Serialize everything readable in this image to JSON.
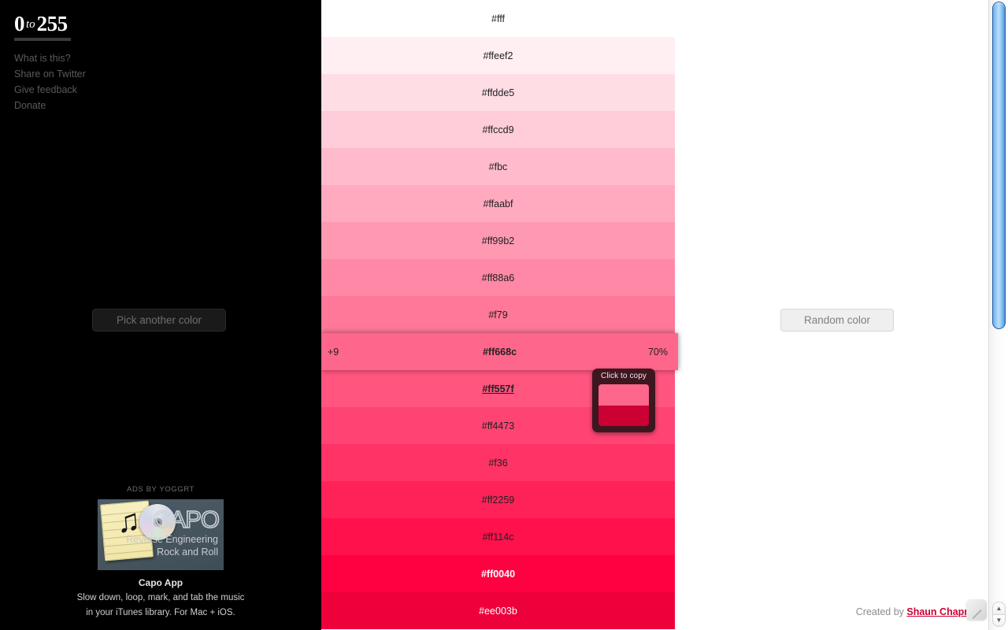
{
  "sidebar": {
    "logo": {
      "start": "0",
      "middle": "to",
      "end": "255"
    },
    "nav": [
      {
        "label": "What is this?"
      },
      {
        "label": "Share on Twitter"
      },
      {
        "label": "Give feedback"
      },
      {
        "label": "Donate"
      }
    ],
    "pick_button": "Pick another color",
    "ad": {
      "by": "ADS BY YOGGRT",
      "brand": "CAPO",
      "tagline_line1": "Reverse Engineering",
      "tagline_line2": "Rock and Roll",
      "title": "Capo App",
      "desc_line1": "Slow down, loop, mark, and tab the music",
      "desc_line2": "in your iTunes library. For Mac + iOS.",
      "note_icon": "music-note-icon",
      "disc_icon": "compact-disc-icon"
    }
  },
  "main": {
    "random_button": "Random color",
    "credit_prefix": "Created by ",
    "credit_author": "Shaun Chapman"
  },
  "tooltip": {
    "label": "Click to copy",
    "top_color": "#ff668c",
    "bottom_color": "#cc0033",
    "background": "#3d1620"
  },
  "swatches": [
    {
      "hex": "#fff",
      "color": "#ffffff",
      "light_text": false,
      "state": "normal"
    },
    {
      "hex": "#ffeef2",
      "color": "#ffeef2",
      "light_text": false,
      "state": "normal"
    },
    {
      "hex": "#ffdde5",
      "color": "#ffdde5",
      "light_text": false,
      "state": "normal"
    },
    {
      "hex": "#ffccd9",
      "color": "#ffccd9",
      "light_text": false,
      "state": "normal"
    },
    {
      "hex": "#fbc",
      "color": "#ffbbcc",
      "light_text": false,
      "state": "normal"
    },
    {
      "hex": "#ffaabf",
      "color": "#ffaabf",
      "light_text": false,
      "state": "normal"
    },
    {
      "hex": "#ff99b2",
      "color": "#ff99b2",
      "light_text": false,
      "state": "normal"
    },
    {
      "hex": "#ff88a6",
      "color": "#ff88a6",
      "light_text": false,
      "state": "normal"
    },
    {
      "hex": "#f79",
      "color": "#ff7799",
      "light_text": false,
      "state": "normal"
    },
    {
      "hex": "#ff668c",
      "color": "#ff668c",
      "light_text": false,
      "state": "selected",
      "delta": "+9",
      "percent": "70%"
    },
    {
      "hex": "#ff557f",
      "color": "#ff557f",
      "light_text": false,
      "state": "hovered"
    },
    {
      "hex": "#ff4473",
      "color": "#ff4473",
      "light_text": false,
      "state": "normal"
    },
    {
      "hex": "#f36",
      "color": "#ff3366",
      "light_text": false,
      "state": "normal"
    },
    {
      "hex": "#ff2259",
      "color": "#ff2259",
      "light_text": false,
      "state": "normal"
    },
    {
      "hex": "#ff114c",
      "color": "#ff114c",
      "light_text": false,
      "state": "normal"
    },
    {
      "hex": "#ff0040",
      "color": "#ff0040",
      "light_text": true,
      "state": "base"
    },
    {
      "hex": "#ee003b",
      "color": "#ee003b",
      "light_text": true,
      "state": "normal"
    }
  ],
  "scrollbar": {
    "up_arrow": "▲",
    "down_arrow": "▼"
  }
}
